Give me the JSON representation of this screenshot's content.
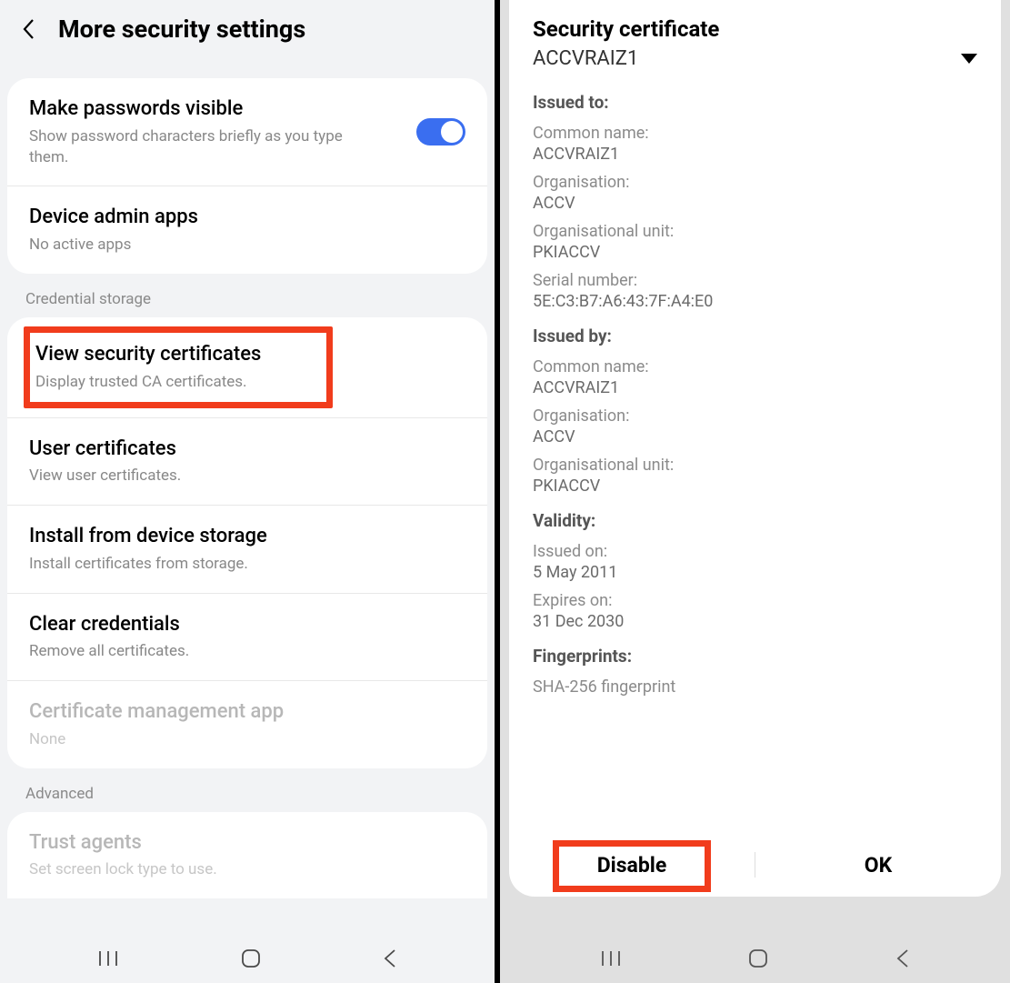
{
  "left": {
    "header_title": "More security settings",
    "passwords": {
      "title": "Make passwords visible",
      "sub": "Show password characters briefly as you type them.",
      "toggle_on": true
    },
    "admin": {
      "title": "Device admin apps",
      "sub": "No active apps"
    },
    "section_cred": "Credential storage",
    "view_cert": {
      "title": "View security certificates",
      "sub": "Display trusted CA certificates."
    },
    "user_cert": {
      "title": "User certificates",
      "sub": "View user certificates."
    },
    "install": {
      "title": "Install from device storage",
      "sub": "Install certificates from storage."
    },
    "clear": {
      "title": "Clear credentials",
      "sub": "Remove all certificates."
    },
    "cert_mgmt": {
      "title": "Certificate management app",
      "sub": "None"
    },
    "section_adv": "Advanced",
    "trust_agents": {
      "title": "Trust agents",
      "sub": "Set screen lock type to use."
    }
  },
  "right": {
    "sheet_title": "Security certificate",
    "cert_name": "ACCVRAIZ1",
    "issued_to": {
      "heading": "Issued to:",
      "common_name_label": "Common name:",
      "common_name": "ACCVRAIZ1",
      "org_label": "Organisation:",
      "org": "ACCV",
      "ou_label": "Organisational unit:",
      "ou": "PKIACCV",
      "serial_label": "Serial number:",
      "serial": "5E:C3:B7:A6:43:7F:A4:E0"
    },
    "issued_by": {
      "heading": "Issued by:",
      "common_name_label": "Common name:",
      "common_name": "ACCVRAIZ1",
      "org_label": "Organisation:",
      "org": "ACCV",
      "ou_label": "Organisational unit:",
      "ou": "PKIACCV"
    },
    "validity": {
      "heading": "Validity:",
      "issued_label": "Issued on:",
      "issued": "5 May 2011",
      "expires_label": "Expires on:",
      "expires": "31 Dec 2030"
    },
    "fingerprints": {
      "heading": "Fingerprints:",
      "sha256_label": "SHA-256 fingerprint"
    },
    "btn_disable": "Disable",
    "btn_ok": "OK"
  }
}
